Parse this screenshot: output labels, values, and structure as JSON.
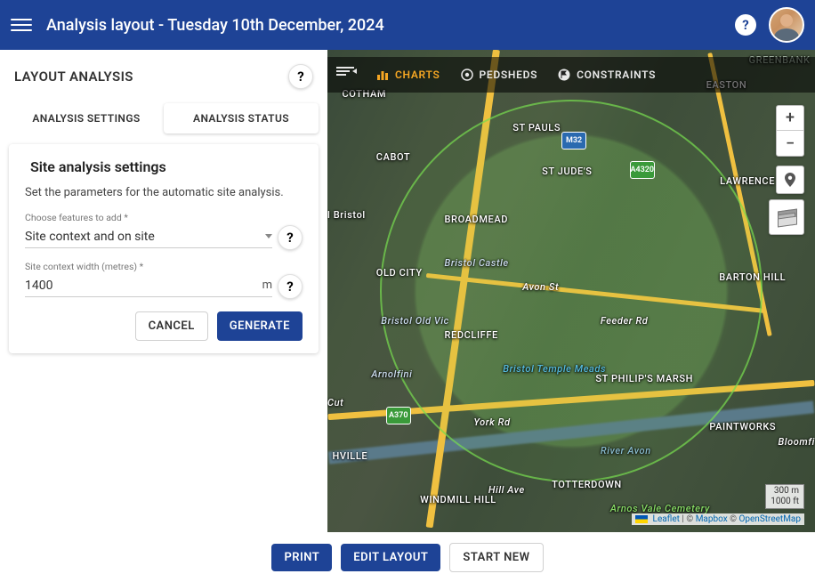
{
  "appbar": {
    "title": "Analysis layout - Tuesday 10th December, 2024"
  },
  "sidepanel": {
    "title": "LAYOUT ANALYSIS",
    "tabs": [
      "ANALYSIS SETTINGS",
      "ANALYSIS STATUS"
    ],
    "active_tab": 1
  },
  "card": {
    "heading": "Site analysis settings",
    "description": "Set the parameters for the automatic site analysis.",
    "feature_field": {
      "label": "Choose features to add *",
      "value": "Site context and on site"
    },
    "width_field": {
      "label": "Site context width (metres) *",
      "value": "1400",
      "unit": "m"
    },
    "cancel_label": "CANCEL",
    "generate_label": "GENERATE"
  },
  "map_toolbar": {
    "charts": "CHARTS",
    "pedsheds": "PEDSHEDS",
    "constraints": "CONSTRAINTS"
  },
  "map_places": {
    "cotham": "COTHAM",
    "stpauls": "ST PAULS",
    "easton": "EASTON",
    "greenbank": "GREENBANK",
    "cabot": "CABOT",
    "stjudes": "ST JUDE'S",
    "lawrencehill": "LAWRENCE HILL",
    "bristol": "l Bristol",
    "broadmead": "BROADMEAD",
    "oldcity": "OLD CITY",
    "bristolcastle": "Bristol Castle",
    "bartonhill": "BARTON HILL",
    "avonst": "Avon St",
    "bristololdvic": "Bristol Old Vic",
    "redcliffe": "REDCLIFFE",
    "feederrd": "Feeder Rd",
    "arnolfini": "Arnolfini",
    "temple": "Bristol Temple Meads",
    "stphilips": "ST PHILIP'S MARSH",
    "cut": "Cut",
    "yorkrd": "York Rd",
    "paintworks": "PAINTWORKS",
    "riveravon": "River Avon",
    "shville": "HVILLE",
    "bloomfi": "Bloomfi",
    "windmill": "WINDMILL HILL",
    "hillave": "Hill Ave",
    "totterdown": "TOTTERDOWN",
    "arnosvale": "Arnos Vale Cemetery",
    "m32": "M32",
    "a4320": "A4320",
    "a370": "A370"
  },
  "scale": {
    "top": "300 m",
    "bottom": "1000 ft"
  },
  "attribution": {
    "leaflet": " Leaflet",
    "sep1": " | © ",
    "mapbox": "Mapbox",
    "sep2": " © ",
    "osm": "OpenStreetMap"
  },
  "footer": {
    "print": "PRINT",
    "edit": "EDIT LAYOUT",
    "startnew": "START NEW"
  }
}
